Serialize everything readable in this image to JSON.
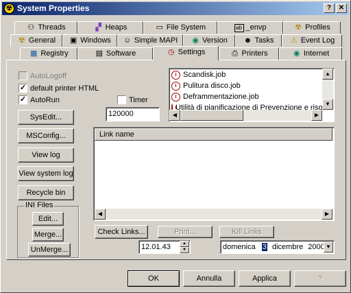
{
  "window": {
    "title": "System Properties",
    "icon": "radiation-icon"
  },
  "titlebar_buttons": {
    "help": "?",
    "close": "✕"
  },
  "tabs": {
    "row1": [
      {
        "label": "Threads",
        "icon": "binoculars-icon"
      },
      {
        "label": "Heaps",
        "icon": "blocks-icon"
      },
      {
        "label": "File System",
        "icon": "drive-icon"
      },
      {
        "label": "_envp",
        "icon": "ab-icon"
      },
      {
        "label": "Profiles",
        "icon": "radiation-icon"
      }
    ],
    "row2": [
      {
        "label": "General",
        "icon": "radiation-icon"
      },
      {
        "label": "Windows",
        "icon": "computer-icon"
      },
      {
        "label": "Simple MAPI",
        "icon": "person-icon"
      },
      {
        "label": "Version",
        "icon": "globe-icon"
      },
      {
        "label": "Tasks",
        "icon": "people-icon"
      },
      {
        "label": "Event Log",
        "icon": "warning-icon"
      }
    ],
    "row3": [
      {
        "label": "Registry",
        "icon": "registry-icon"
      },
      {
        "label": "Software",
        "icon": "software-icon"
      },
      {
        "label": "Settings",
        "icon": "clock-icon"
      },
      {
        "label": "Printers",
        "icon": "printer-icon"
      },
      {
        "label": "Internet",
        "icon": "globe-icon"
      }
    ]
  },
  "settings": {
    "autologoff": {
      "label": "AutoLogoff",
      "checked": false,
      "enabled": false
    },
    "default_printer_html": {
      "label": "default printer HTML",
      "checked": true
    },
    "autorun": {
      "label": "AutoRun",
      "checked": true
    },
    "timer": {
      "label": "Timer",
      "checked": false
    },
    "timer_value": "120000",
    "jobs": [
      "Scandisk.job",
      "Pulitura disco.job",
      "Deframmentazione.job",
      "Utilità di pianificazione di Prevenzione e risol"
    ],
    "buttons": {
      "sysedit": "SysEdit...",
      "msconfig": "MSConfig...",
      "view_log": "View log",
      "view_system_log": "View system log",
      "recycle_bin": "Recycle bin"
    },
    "ini_files": {
      "title": "INI Files",
      "edit": "Edit...",
      "merge": "Merge...",
      "unmerge": "UnMerge..."
    },
    "link_table": {
      "column": "Link name",
      "rows": []
    },
    "link_buttons": {
      "check": "Check Links...",
      "print": "Print...",
      "kill": "Kill Links"
    },
    "time_value": "12.01.43",
    "date": {
      "weekday": "domenica",
      "day": "3",
      "month": "dicembre",
      "year": "2000"
    }
  },
  "footer": {
    "ok": "OK",
    "cancel": "Annulla",
    "apply": "Applica",
    "help": "?"
  }
}
